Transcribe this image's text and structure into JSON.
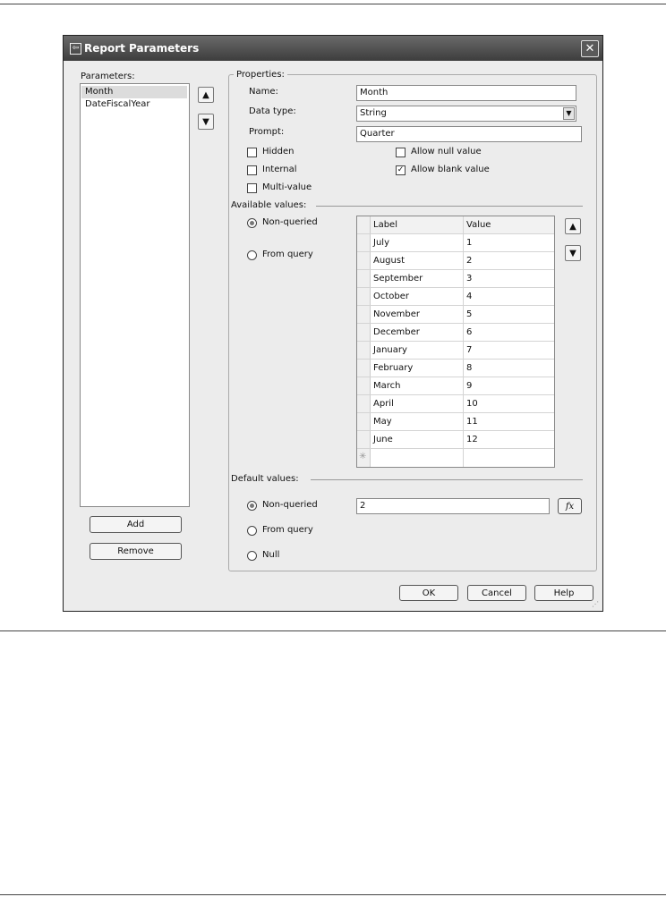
{
  "dialog": {
    "title": "Report Parameters",
    "close_glyph": "✕",
    "icon": "dialog-app-icon"
  },
  "parameters": {
    "label": "Parameters:",
    "items": [
      "Month",
      "DateFiscalYear"
    ],
    "selected": "Month",
    "add_label": "Add",
    "remove_label": "Remove"
  },
  "properties": {
    "caption": "Properties:",
    "name_label": "Name:",
    "name_value": "Month",
    "datatype_label": "Data type:",
    "datatype_value": "String",
    "prompt_label": "Prompt:",
    "prompt_value": "Quarter",
    "hidden_label": "Hidden",
    "internal_label": "Internal",
    "multivalue_label": "Multi-value",
    "allow_null_label": "Allow null value",
    "allow_blank_label": "Allow blank value",
    "hidden_checked": false,
    "internal_checked": false,
    "multivalue_checked": false,
    "allow_null_checked": false,
    "allow_blank_checked": true
  },
  "available": {
    "caption": "Available values:",
    "non_queried_label": "Non-queried",
    "from_query_label": "From query",
    "selected": "Non-queried",
    "columns": [
      "Label",
      "Value"
    ],
    "rows": [
      [
        "July",
        "1"
      ],
      [
        "August",
        "2"
      ],
      [
        "September",
        "3"
      ],
      [
        "October",
        "4"
      ],
      [
        "November",
        "5"
      ],
      [
        "December",
        "6"
      ],
      [
        "January",
        "7"
      ],
      [
        "February",
        "8"
      ],
      [
        "March",
        "9"
      ],
      [
        "April",
        "10"
      ],
      [
        "May",
        "11"
      ],
      [
        "June",
        "12"
      ]
    ],
    "new_row_glyph": "✳"
  },
  "defaults": {
    "caption": "Default values:",
    "non_queried_label": "Non-queried",
    "from_query_label": "From query",
    "null_label": "Null",
    "selected": "Non-queried",
    "value": "2",
    "fx_label": "fx"
  },
  "footer": {
    "ok_label": "OK",
    "cancel_label": "Cancel",
    "help_label": "Help"
  }
}
